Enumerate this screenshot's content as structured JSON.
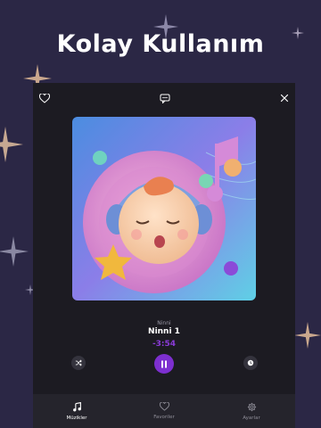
{
  "headline": "Kolay Kullanım",
  "player": {
    "track_subtitle": "Ninni",
    "track_title": "Ninni 1",
    "remaining_time": "-3:54",
    "accent_color": "#7d2fd0"
  },
  "top_bar": {
    "left_icon": "heart-outline-icon",
    "center_icon": "chat-bubble-icon",
    "right_icon": "close-icon"
  },
  "controls": {
    "left_icon": "shuffle-icon",
    "center_icon": "pause-icon",
    "right_icon": "timer-icon"
  },
  "tabs": [
    {
      "label": "Müzikler",
      "icon": "music-note-icon",
      "active": true
    },
    {
      "label": "Favoriler",
      "icon": "heart-outline-icon",
      "active": false
    },
    {
      "label": "Ayarlar",
      "icon": "gear-icon",
      "active": false
    }
  ],
  "colors": {
    "background": "#2b2745",
    "phone_background": "#1c1b22",
    "tab_bar": "#25242c"
  }
}
